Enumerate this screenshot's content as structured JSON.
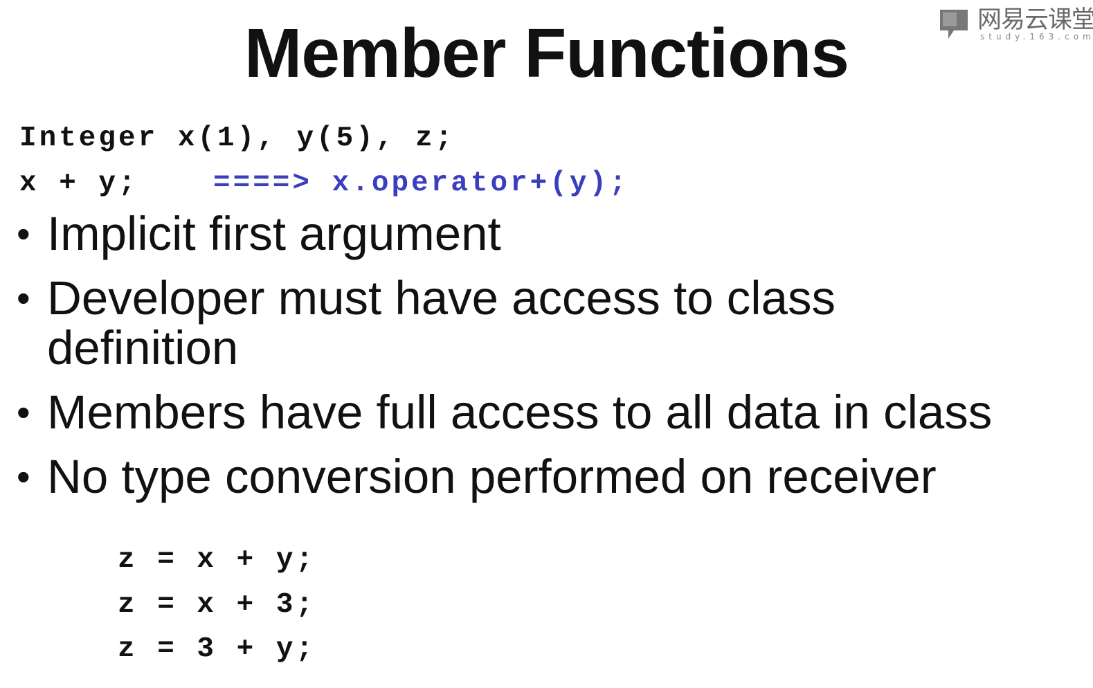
{
  "slide": {
    "title": "Member Functions",
    "watermark": {
      "text": "网易云课堂",
      "subtext": "study.163.com",
      "icon": "chat-bubble-logo-icon"
    },
    "code_top": [
      {
        "text": "Integer x(1), y(5), z;"
      },
      {
        "expr": "x + y;",
        "arrow": "====>",
        "rewrite": "x.operator+(y);"
      }
    ],
    "bullets": [
      "Implicit first argument",
      "Developer must have access to class definition",
      "Members have full access to all data in class",
      "No type conversion performed on receiver"
    ],
    "bullet_symbol": "•",
    "code_bottom": [
      "z = x + y;",
      "z = x + 3;",
      "z = 3 + y;"
    ],
    "colors": {
      "text": "#111111",
      "accent": "#3b3fbf",
      "watermark": "#6a6a6a",
      "background": "#ffffff"
    }
  }
}
